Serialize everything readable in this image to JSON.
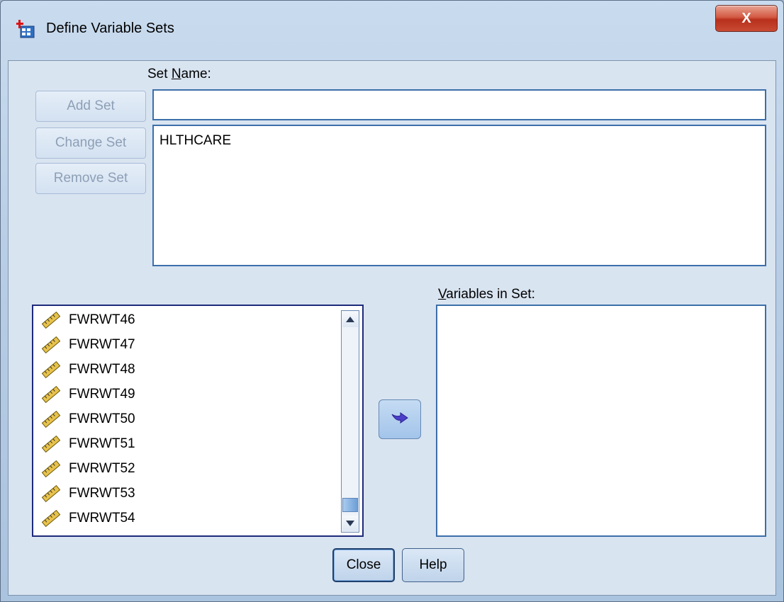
{
  "window": {
    "title": "Define Variable Sets",
    "close_glyph": "X"
  },
  "set_name": {
    "label": "Set Name:",
    "value": ""
  },
  "buttons": {
    "add_set": "Add Set",
    "change_set": "Change Set",
    "remove_set": "Remove Set",
    "close": "Close",
    "help": "Help"
  },
  "defined_sets": [
    "HLTHCARE"
  ],
  "source_variables": [
    "FWRWT46",
    "FWRWT47",
    "FWRWT48",
    "FWRWT49",
    "FWRWT50",
    "FWRWT51",
    "FWRWT52",
    "FWRWT53",
    "FWRWT54"
  ],
  "variables_in_set": {
    "label": "Variables in Set:",
    "items": []
  },
  "icons": {
    "window_icon": "spss-dataset-icon",
    "variable_icon": "ruler-scale-icon",
    "move_icon": "arrow-right-icon"
  },
  "colors": {
    "accent": "#3c6fa9",
    "disabled_text": "#8d9fb6"
  }
}
